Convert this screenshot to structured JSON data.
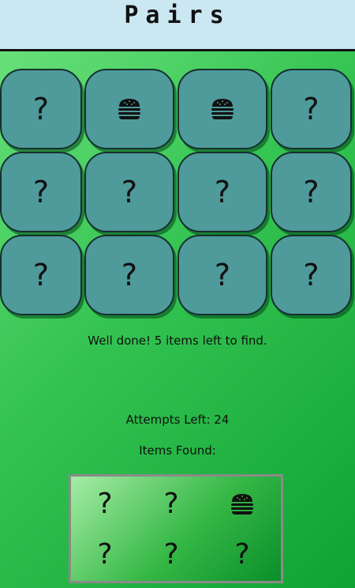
{
  "header": {
    "title": "Pairs"
  },
  "grid": {
    "cards": [
      {
        "face": "?",
        "icon": ""
      },
      {
        "face": "",
        "icon": "hamburger-icon"
      },
      {
        "face": "",
        "icon": "hamburger-icon"
      },
      {
        "face": "?",
        "icon": ""
      },
      {
        "face": "?",
        "icon": ""
      },
      {
        "face": "?",
        "icon": ""
      },
      {
        "face": "?",
        "icon": ""
      },
      {
        "face": "?",
        "icon": ""
      },
      {
        "face": "?",
        "icon": ""
      },
      {
        "face": "?",
        "icon": ""
      },
      {
        "face": "?",
        "icon": ""
      },
      {
        "face": "?",
        "icon": ""
      }
    ]
  },
  "status": {
    "message": "Well done! 5 items left to find.",
    "attempts": "Attempts Left: 24",
    "items_found_label": "Items Found:"
  },
  "found": {
    "slots": [
      {
        "face": "?",
        "icon": ""
      },
      {
        "face": "?",
        "icon": ""
      },
      {
        "face": "",
        "icon": "hamburger-icon"
      },
      {
        "face": "?",
        "icon": ""
      },
      {
        "face": "?",
        "icon": ""
      },
      {
        "face": "?",
        "icon": ""
      }
    ]
  },
  "colors": {
    "card": "#4f9a9a",
    "header": "#cbe7f1"
  }
}
